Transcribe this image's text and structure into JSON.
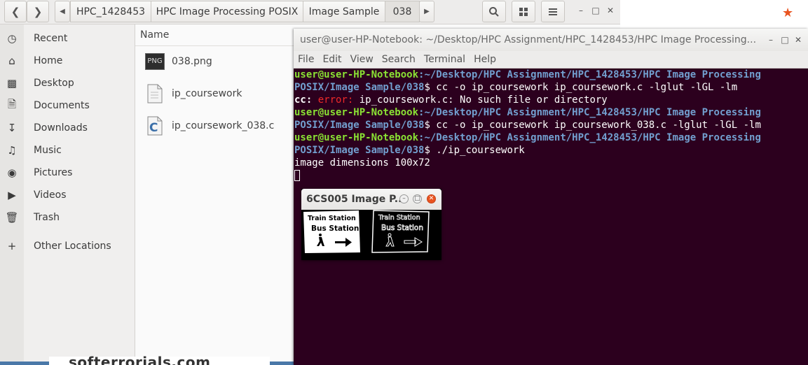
{
  "nautilus": {
    "breadcrumbs": [
      "HPC_1428453",
      "HPC Image Processing POSIX",
      "Image Sample",
      "038"
    ],
    "column_name": "Name",
    "sidebar": [
      {
        "label": "Recent",
        "icon": "clock-icon"
      },
      {
        "label": "Home",
        "icon": "home-icon"
      },
      {
        "label": "Desktop",
        "icon": "folder-icon"
      },
      {
        "label": "Documents",
        "icon": "document-icon"
      },
      {
        "label": "Downloads",
        "icon": "download-icon"
      },
      {
        "label": "Music",
        "icon": "music-icon"
      },
      {
        "label": "Pictures",
        "icon": "camera-icon"
      },
      {
        "label": "Videos",
        "icon": "video-icon"
      },
      {
        "label": "Trash",
        "icon": "trash-icon"
      },
      {
        "label": "Other Locations",
        "icon": "plus-icon"
      }
    ],
    "files": [
      {
        "name": "038.png",
        "icon": "png-file-icon",
        "badge": "PNG"
      },
      {
        "name": "ip_coursework",
        "icon": "executable-file-icon"
      },
      {
        "name": "ip_coursework_038.c",
        "icon": "c-source-file-icon"
      }
    ]
  },
  "terminal": {
    "title": "user@user-HP-Notebook: ~/Desktop/HPC Assignment/HPC_1428453/HPC Image Processing...",
    "menu": [
      "File",
      "Edit",
      "View",
      "Search",
      "Terminal",
      "Help"
    ],
    "user_host": "user@user-HP-Notebook",
    "path_part1": "~/Desktop/HPC Assignment/HPC_1428453/HPC Image Processing",
    "path_part2": "POSIX/Image Sample/038",
    "cmd1": "$ cc -o ip_coursework ip_coursework.c -lglut -lGL -lm",
    "err_prefix": "cc: ",
    "err_word": "error:",
    "err_msg": " ip_coursework.c: No such file or directory",
    "cmd2": "$ cc -o ip_coursework ip_coursework_038.c -lglut -lGL -lm",
    "cmd3": "$ ./ip_coursework",
    "output": "image dimensions 100x72"
  },
  "glut_window": {
    "title": "6CS005 Image P...",
    "sign_line1": "Train Station",
    "sign_line2": "Bus Station"
  },
  "background": {
    "bottom_text": "softerrorials.com"
  },
  "colors": {
    "terminal_bg": "#2c001e",
    "prompt_user": "#8ae234",
    "prompt_path": "#729fcf",
    "error": "#ef2929",
    "accent": "#e95420"
  }
}
